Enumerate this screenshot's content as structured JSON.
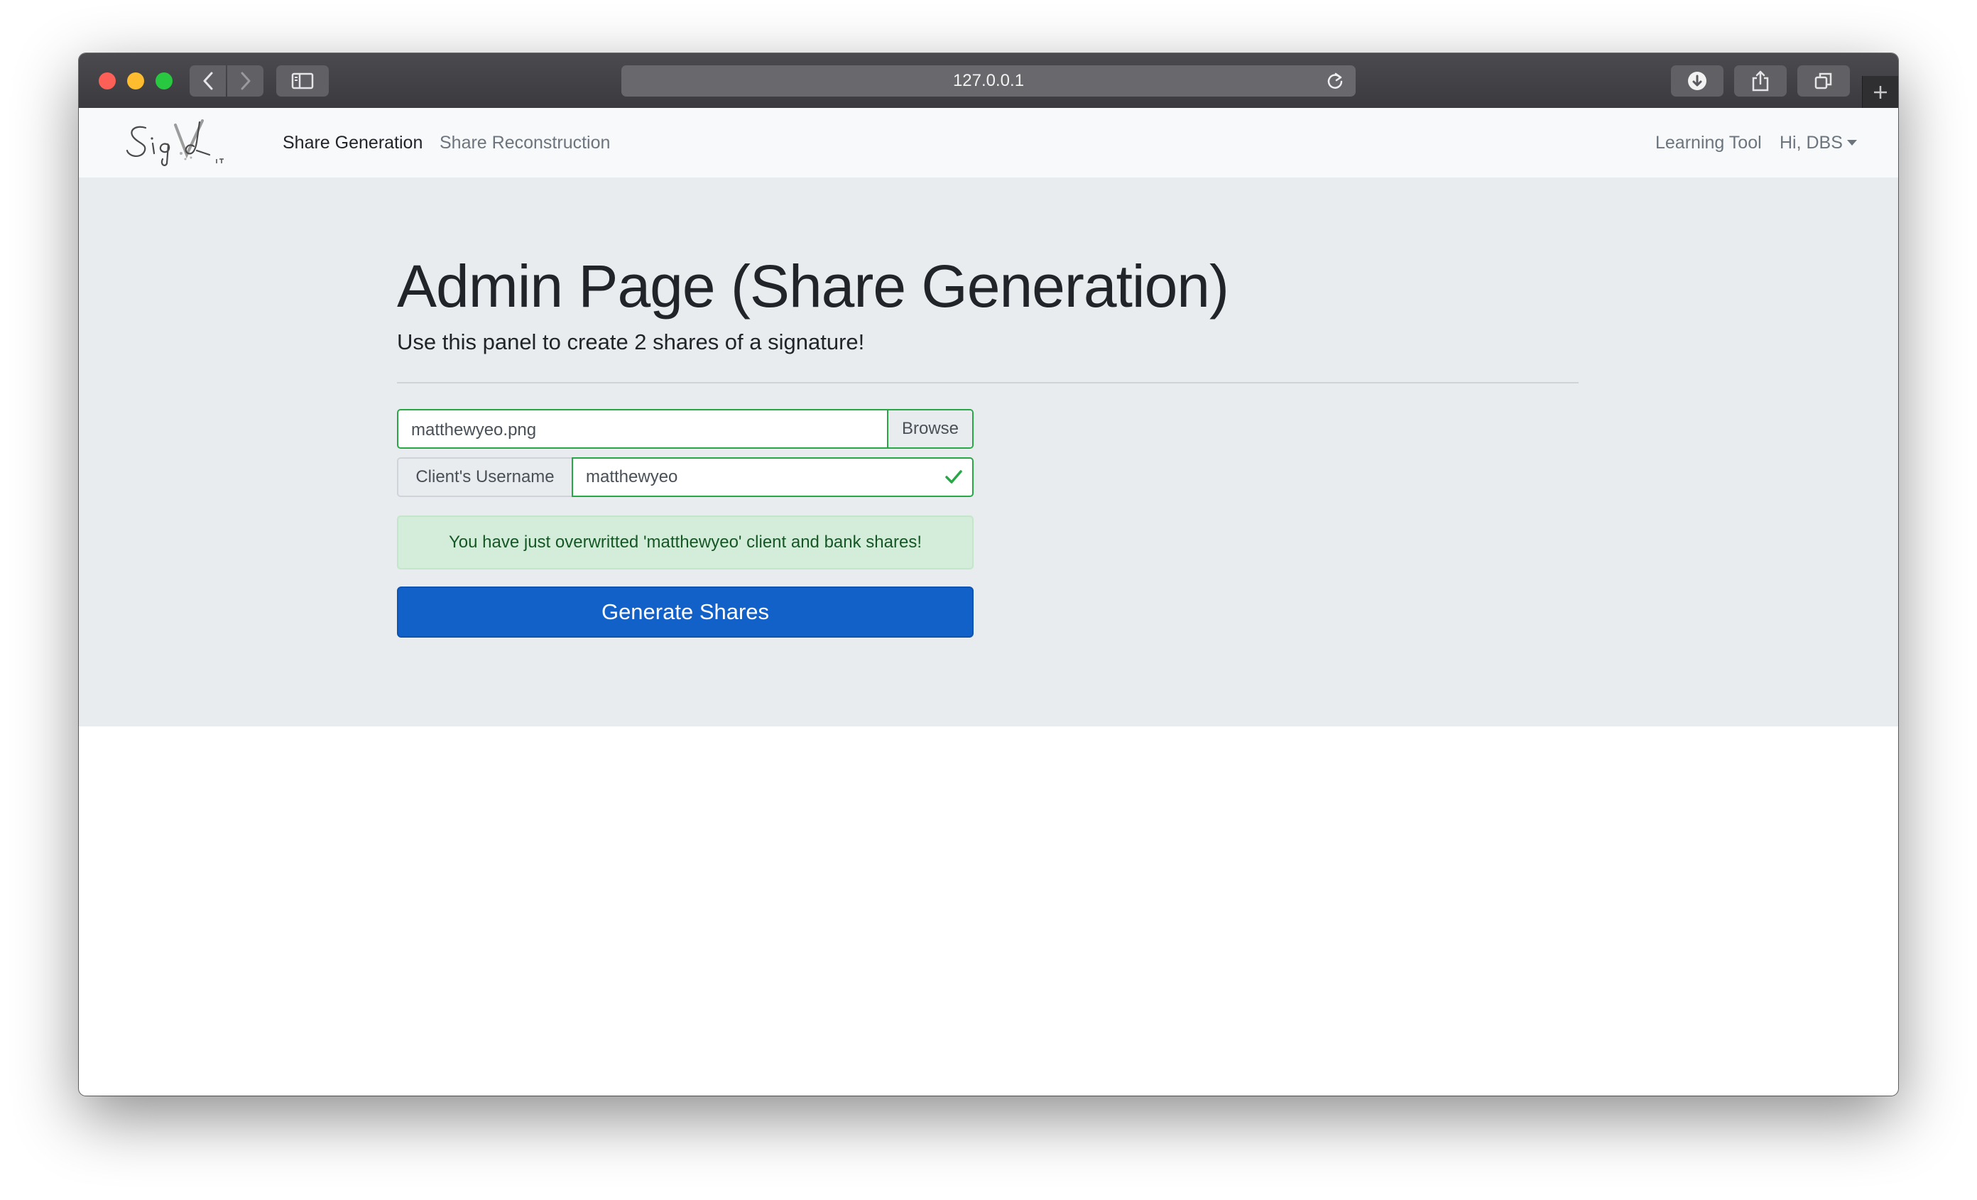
{
  "browser": {
    "address": "127.0.0.1"
  },
  "navbar": {
    "logo_text": "SignIT",
    "links": [
      "Share Generation",
      "Share Reconstruction"
    ],
    "right_links": [
      "Learning Tool",
      "Hi, DBS"
    ]
  },
  "main": {
    "title": "Admin Page (Share Generation)",
    "lead": "Use this panel to create 2 shares of a signature!",
    "file_input": {
      "value": "matthewyeo.png",
      "browse_label": "Browse"
    },
    "username": {
      "label": "Client's Username",
      "value": "matthewyeo"
    },
    "alert": "You have just overwritted 'matthewyeo' client and bank shares!",
    "button": "Generate Shares"
  },
  "colors": {
    "primary": "#1161c9",
    "success": "#28a745",
    "alert_bg": "#d4edda",
    "alert_text": "#155724",
    "jumbotron": "#e9ecef",
    "navbar": "#f8f9fa"
  }
}
